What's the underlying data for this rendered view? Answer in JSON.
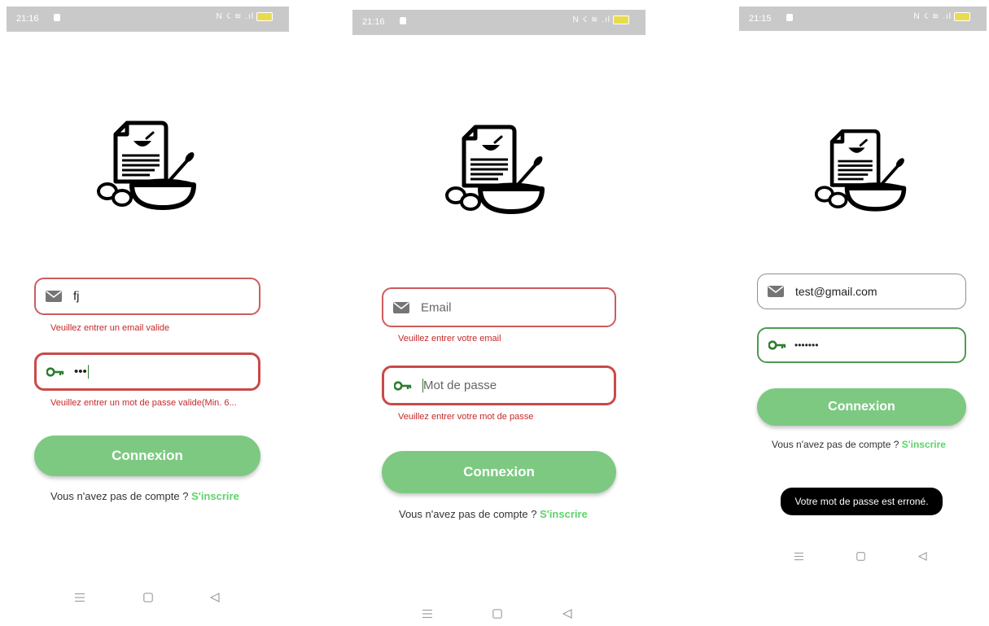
{
  "screens": [
    {
      "status": {
        "time": "21:16",
        "indicators": "N ☇ ≋ .ıl"
      },
      "email": {
        "value": "fj",
        "placeholder": "Email",
        "error": "Veuillez entrer un email valide"
      },
      "password": {
        "value": "•••",
        "placeholder": "Mot de passe",
        "error": "Veuillez entrer un mot de passe valide(Min. 6..."
      },
      "button": "Connexion",
      "signup": {
        "prompt": "Vous n'avez pas de compte ?",
        "link": "S'inscrire"
      }
    },
    {
      "status": {
        "time": "21:16",
        "indicators": "N ☇ ≋ .ıl"
      },
      "email": {
        "value": "",
        "placeholder": "Email",
        "error": "Veuillez entrer votre email"
      },
      "password": {
        "value": "",
        "placeholder": "Mot de passe",
        "error": "Veuillez entrer votre mot de passe"
      },
      "button": "Connexion",
      "signup": {
        "prompt": "Vous n'avez pas de compte ?",
        "link": "S'inscrire"
      }
    },
    {
      "status": {
        "time": "21:15",
        "indicators": "N ☇ ≋ .ıl"
      },
      "email": {
        "value": "test@gmail.com",
        "placeholder": "Email"
      },
      "password": {
        "value": "•••••••",
        "placeholder": "Mot de passe"
      },
      "button": "Connexion",
      "signup": {
        "prompt": "Vous n'avez pas de compte ?",
        "link": "S'inscrire"
      },
      "toast": "Votre mot de passe est erroné."
    }
  ],
  "colors": {
    "primary_button": "#7dc982",
    "link": "#5dd36a",
    "error": "#c62828",
    "valid_border": "#4e9a55",
    "key_icon": "#2e7d32",
    "mail_icon": "#757575"
  },
  "icons": {
    "email_field": "mail-icon",
    "password_field": "key-icon",
    "logo": "recipe-bowl-logo",
    "nav": [
      "menu-icon",
      "home-square-icon",
      "back-triangle-icon"
    ]
  }
}
